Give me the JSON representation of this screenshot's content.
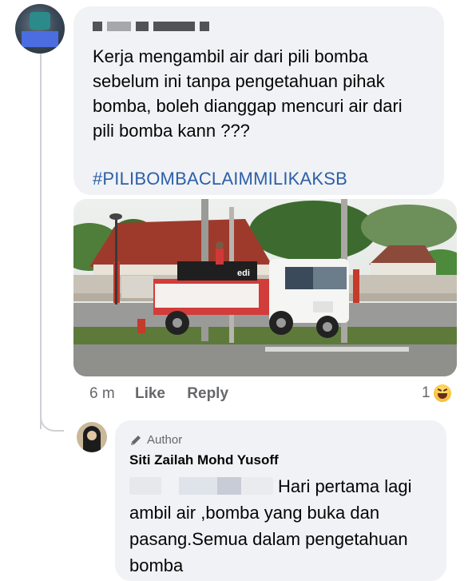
{
  "comment": {
    "text": "Kerja mengambil air dari pili bomba\nsebelum ini tanpa pengetahuan pihak\nbomba, boleh dianggap mencuri air dari\npili bomba kann ???",
    "hashtag": "#PILIBOMBACLAIMMILIKAKSB",
    "photo_truck_label": "edi",
    "time": "6 m",
    "like_label": "Like",
    "reply_label": "Reply",
    "reaction_count": "1",
    "reaction_icon": "haha-icon"
  },
  "reply": {
    "badge_icon": "pencil-icon",
    "badge_label": "Author",
    "author_name": "Siti Zailah Mohd Yusoff",
    "text": "Hari pertama lagi ambil air ,bomba yang buka dan pasang.Semua dalam pengetahuan bomba"
  },
  "colors": {
    "bubble_bg": "#f0f2f5",
    "hashtag": "#2d5fa8",
    "meta_text": "#65676b"
  }
}
